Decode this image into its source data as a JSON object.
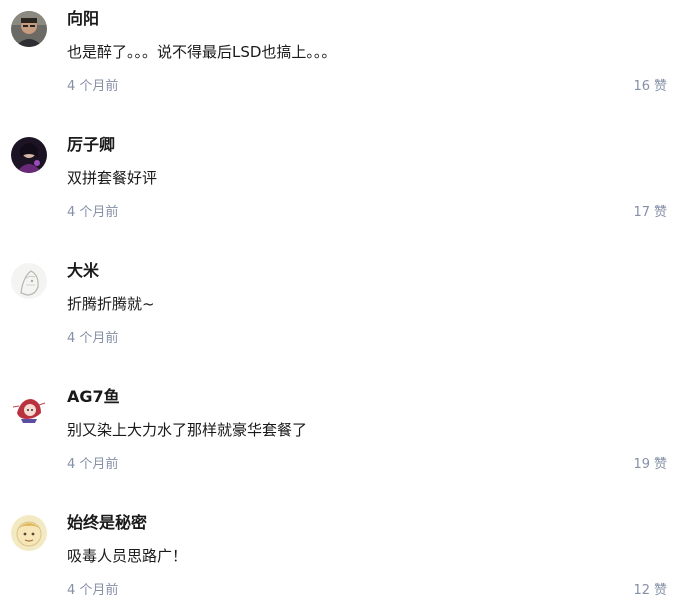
{
  "comments": [
    {
      "author": "向阳",
      "text": "也是醉了。。。说不得最后LSD也搞上。。。",
      "time": "4 个月前",
      "likes": "16",
      "like_label": "赞",
      "avatar": "photo-man-avatar"
    },
    {
      "author": "厉子卿",
      "text": "双拼套餐好评",
      "time": "4 个月前",
      "likes": "17",
      "like_label": "赞",
      "avatar": "dark-portrait-avatar"
    },
    {
      "author": "大米",
      "text": "折腾折腾就~",
      "time": "4 个月前",
      "likes": "",
      "like_label": "",
      "avatar": "sketch-avatar"
    },
    {
      "author": "AG7鱼",
      "text": "别又染上大力水了那样就豪华套餐了",
      "time": "4 个月前",
      "likes": "19",
      "like_label": "赞",
      "avatar": "anime-girl-avatar"
    },
    {
      "author": "始终是秘密",
      "text": "吸毒人员思路广！",
      "time": "4 个月前",
      "likes": "12",
      "like_label": "赞",
      "avatar": "cartoon-face-avatar"
    }
  ],
  "colors": {
    "text": "#1a1a1a",
    "meta": "#8590a6",
    "background": "#ffffff"
  }
}
